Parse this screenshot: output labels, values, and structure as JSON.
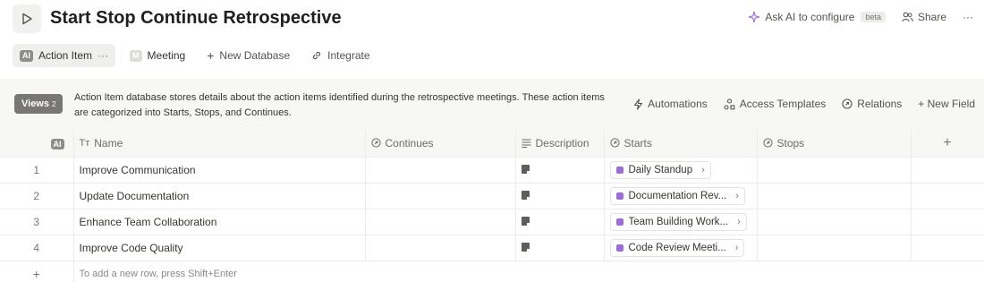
{
  "header": {
    "title": "Start Stop Continue Retrospective",
    "page_icon": "play-icon",
    "ask_ai_label": "Ask AI to configure",
    "beta_label": "beta",
    "share_label": "Share",
    "more_label": "···"
  },
  "tabs": [
    {
      "label": "Action Item",
      "badge": "AI",
      "more": "···"
    },
    {
      "label": "Meeting",
      "badge": "M"
    },
    {
      "label": "New Database",
      "prefix": "+"
    },
    {
      "label": "Integrate"
    }
  ],
  "infobar": {
    "views_label": "Views",
    "views_count": "2",
    "description": "Action Item database stores details about the action items identified during the retrospective meetings. These action items are categorized into Starts, Stops, and Continues.",
    "actions": [
      "Automations",
      "Access Templates",
      "Relations",
      "+ New Field"
    ]
  },
  "table": {
    "index_badge": "AI",
    "columns": [
      "Name",
      "Continues",
      "Description",
      "Starts",
      "Stops"
    ],
    "add_column": "+",
    "rows": [
      {
        "num": "1",
        "name": "Improve Communication",
        "starts": "Daily Standup"
      },
      {
        "num": "2",
        "name": "Update Documentation",
        "starts": "Documentation Rev..."
      },
      {
        "num": "3",
        "name": "Enhance Team Collaboration",
        "starts": "Team Building Work..."
      },
      {
        "num": "4",
        "name": "Improve Code Quality",
        "starts": "Code Review Meeti..."
      }
    ],
    "add_row_plus": "+",
    "add_row_hint": "To add a new row, press Shift+Enter"
  },
  "colors": {
    "accent_purple": "#9a6dd7",
    "views_button": "#787774",
    "panel_bg": "#f7f7f5"
  }
}
